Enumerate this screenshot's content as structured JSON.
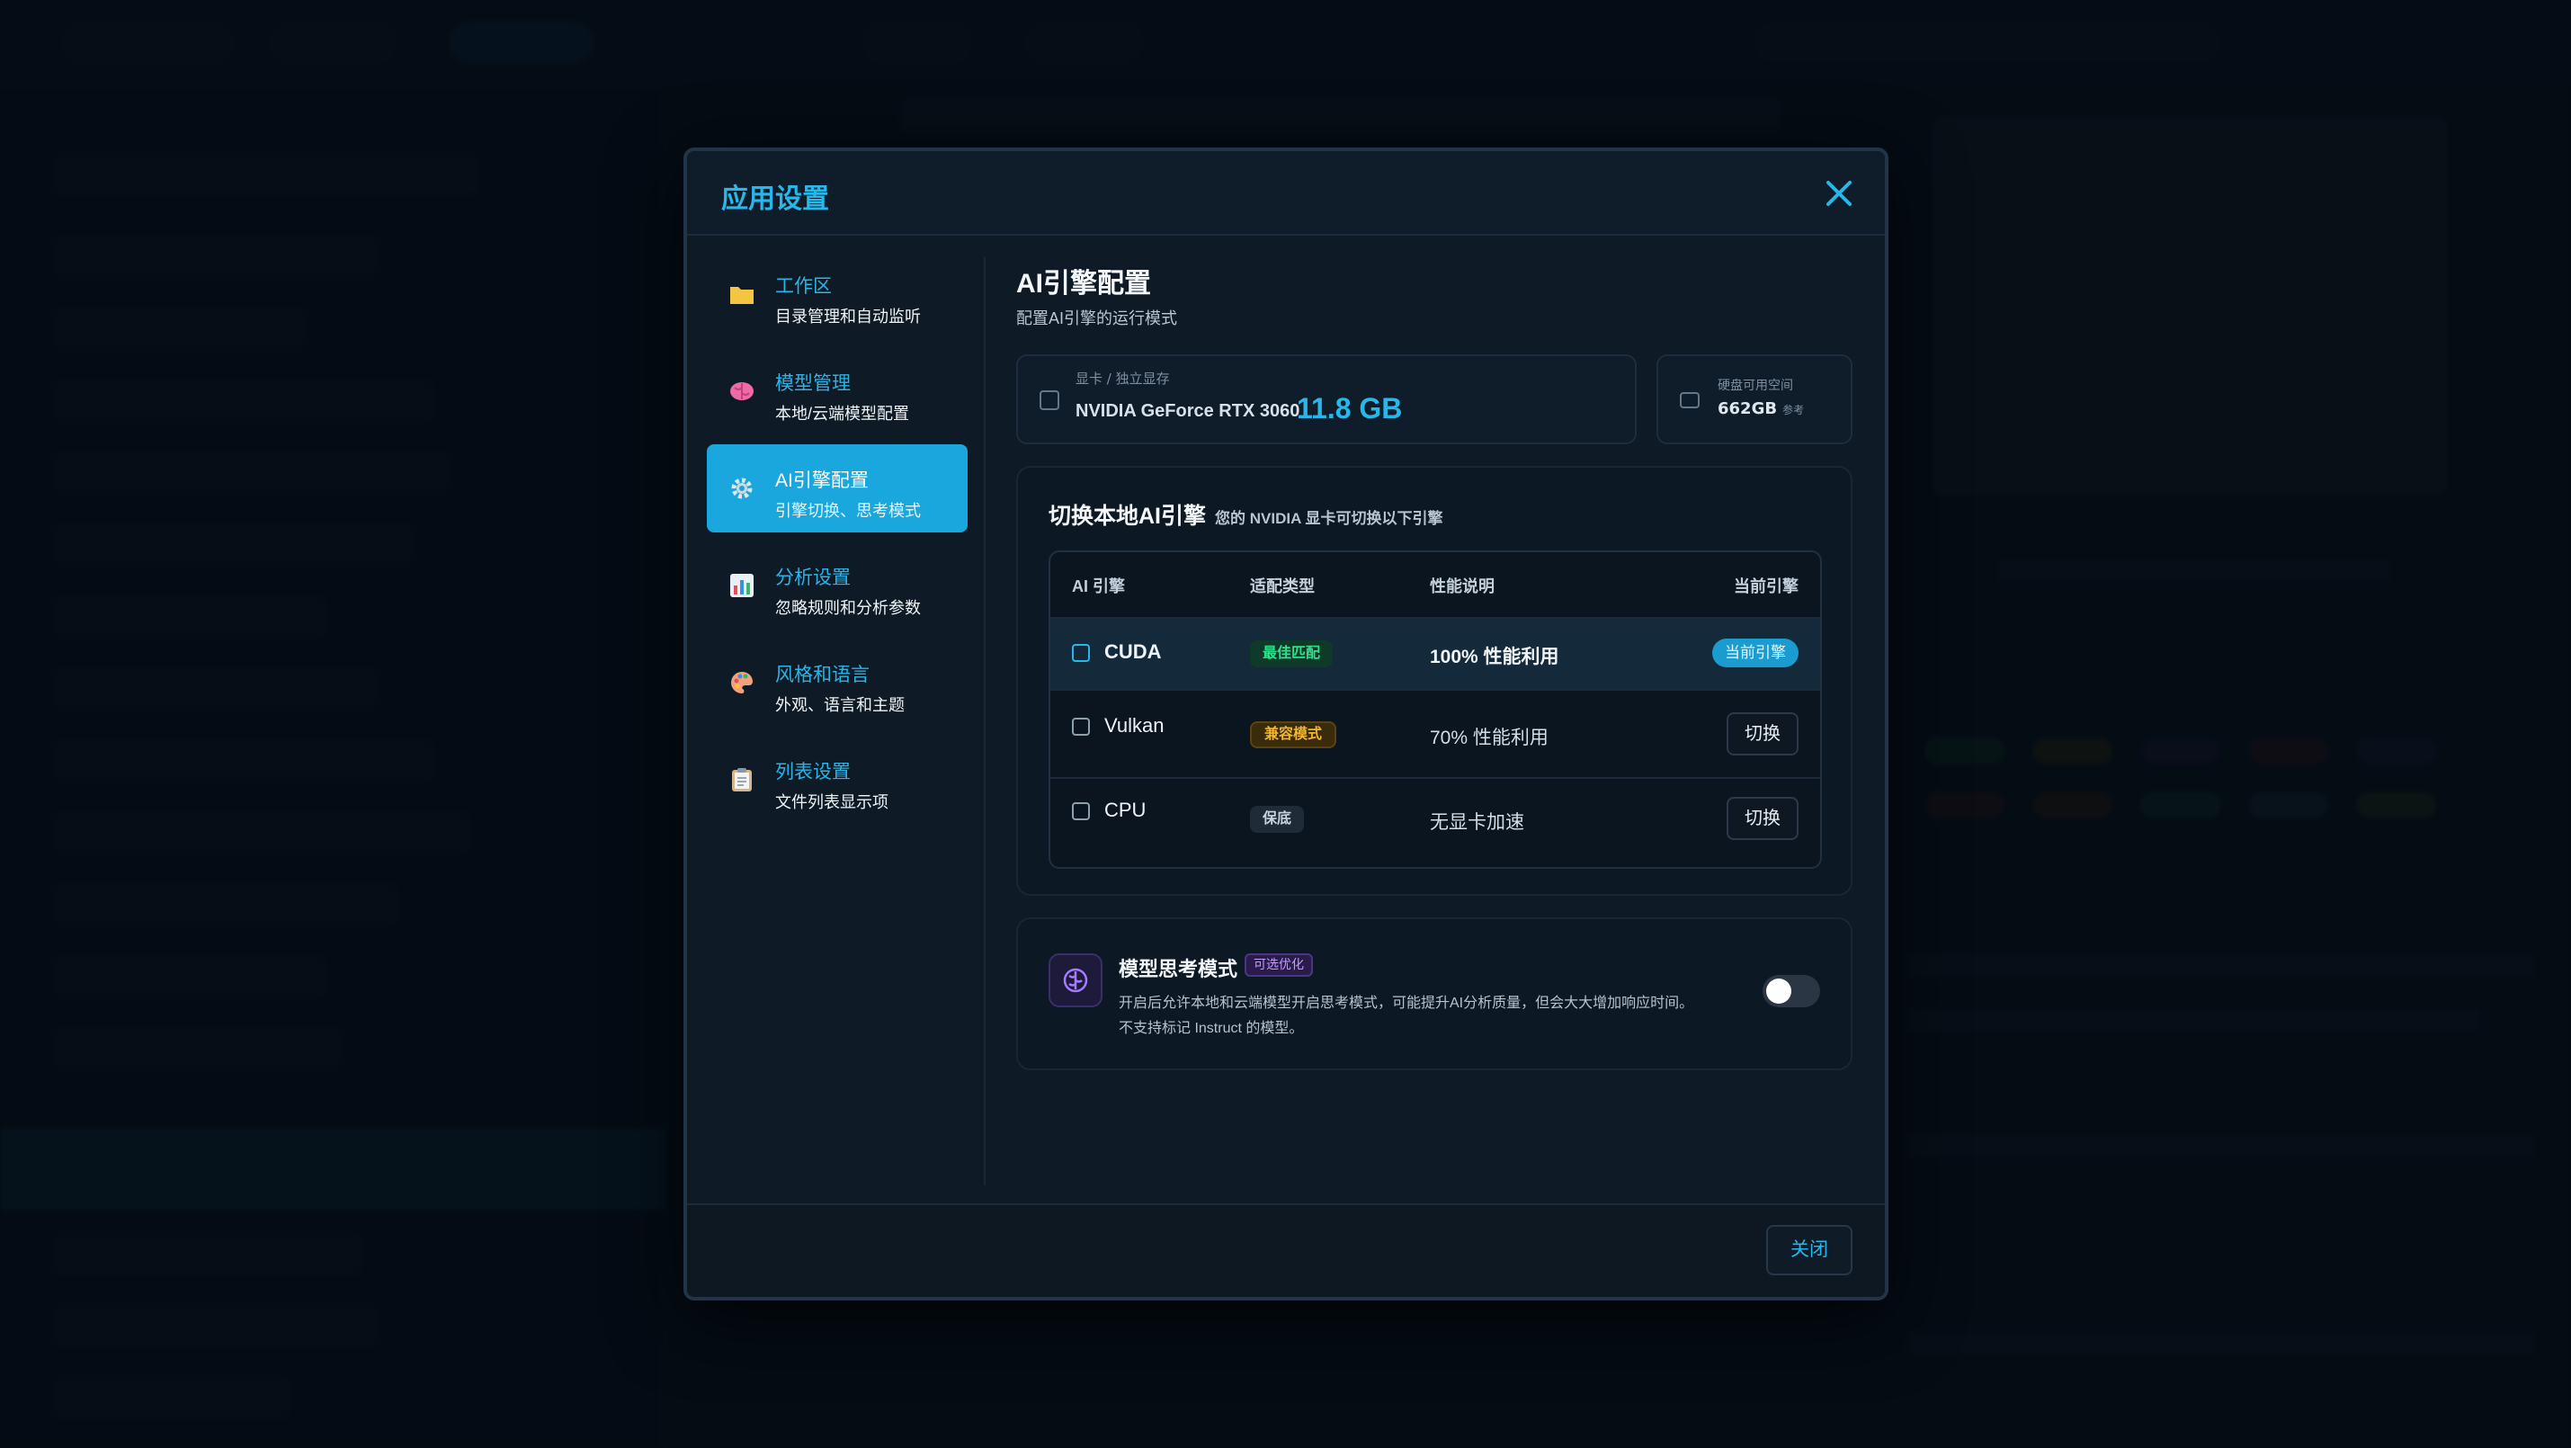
{
  "dialog": {
    "title": "应用设置",
    "close_icon": "close-icon"
  },
  "nav": {
    "items": [
      {
        "label": "工作区",
        "desc": "目录管理和自动监听",
        "icon": "folder-icon",
        "active": false
      },
      {
        "label": "模型管理",
        "desc": "本地/云端模型配置",
        "icon": "brain-icon",
        "active": false
      },
      {
        "label": "AI引擎配置",
        "desc": "引擎切换、思考模式",
        "icon": "gear-icon",
        "active": true
      },
      {
        "label": "分析设置",
        "desc": "忽略规则和分析参数",
        "icon": "bar-chart-icon",
        "active": false
      },
      {
        "label": "风格和语言",
        "desc": "外观、语言和主题",
        "icon": "palette-icon",
        "active": false
      },
      {
        "label": "列表设置",
        "desc": "文件列表显示项",
        "icon": "clipboard-icon",
        "active": false
      }
    ]
  },
  "content": {
    "title": "AI引擎配置",
    "subtitle": "配置AI引擎的运行模式",
    "gpu": {
      "caption": "显卡 / 独立显存",
      "name": "NVIDIA GeForce RTX 3060",
      "memory": "11.8 GB"
    },
    "disk": {
      "caption": "硬盘可用空间",
      "value": "662GB",
      "note": "参考"
    },
    "engine_section": {
      "title": "切换本地AI引擎",
      "subtitle": "您的 NVIDIA 显卡可切换以下引擎",
      "headers": {
        "engine": "AI 引擎",
        "type": "适配类型",
        "perf": "性能说明",
        "current": "当前引擎"
      },
      "rows": [
        {
          "name": "CUDA",
          "badge": "最佳匹配",
          "perf": "100% 性能利用",
          "action": "当前引擎"
        },
        {
          "name": "Vulkan",
          "badge": "兼容模式",
          "perf": "70% 性能利用",
          "action": "切换"
        },
        {
          "name": "CPU",
          "badge": "保底",
          "perf": "无显卡加速",
          "action": "切换"
        }
      ]
    },
    "thinking": {
      "title": "模型思考模式",
      "tag": "可选优化",
      "desc1": "开启后允许本地和云端模型开启思考模式，可能提升AI分析质量，但会大大增加响应时间。",
      "desc2": "不支持标记 Instruct 的模型。",
      "enabled": false
    }
  },
  "footer": {
    "close_label": "关闭"
  },
  "colors": {
    "accent": "#29b6e8",
    "active_nav": "#1aa7dd",
    "best": "#2ee08a",
    "compat": "#f2b52b"
  }
}
